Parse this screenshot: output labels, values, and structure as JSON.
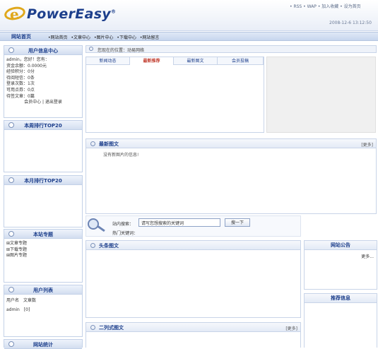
{
  "header": {
    "logo_text": "PowerEasy",
    "logo_mark": "®",
    "top_links": "• RSS • WAP • 加入收藏 • 设为首页",
    "clock": "2008-12-6 13:12:50"
  },
  "nav": {
    "home": "网站首页",
    "items": [
      "•网站首页",
      "•文章中心",
      "•图片中心",
      "•下载中心",
      "•网站留言"
    ]
  },
  "left": {
    "user_center": {
      "title": "用户信息中心",
      "lines": [
        "admin，您好！您有：",
        "资金余额：0.0000元",
        "经验积分：0分",
        "待阅短信：0条",
        "登录次数：1次",
        "可用点券：0点",
        "待签文章：0篇"
      ],
      "links": "会员中心 | 退出登录"
    },
    "week_top": {
      "title": "本周排行TOP20"
    },
    "month_top": {
      "title": "本月排行TOP20"
    },
    "specials": {
      "title": "本站专题",
      "items": [
        "文章专题",
        "下载专题",
        "图片专题"
      ]
    },
    "user_list": {
      "title": "用户列表",
      "header": "用户名　文章数",
      "row": "admin　[0]"
    },
    "stats": {
      "title": "网站统计"
    }
  },
  "main": {
    "location": "您现在的位置：动易网络",
    "tabs": [
      "新闻动态",
      "最新推荐",
      "最新图文",
      "会员投稿"
    ],
    "active_tab": 1,
    "latest_photo": {
      "title": "最新图文",
      "more": "[更多]",
      "empty": "没有新图片的信息!"
    },
    "search": {
      "label": "站内搜索：",
      "input_value": "请写您想搜索的关键词",
      "button": "搜一下",
      "hot": "热门关键词："
    },
    "headline": {
      "title": "头条图文"
    },
    "two_col": {
      "title": "二列式图文",
      "more": "[更多]"
    }
  },
  "right": {
    "notice": {
      "title": "网站公告",
      "more": "更多..."
    },
    "recommend": {
      "title": "推荐信息"
    }
  }
}
